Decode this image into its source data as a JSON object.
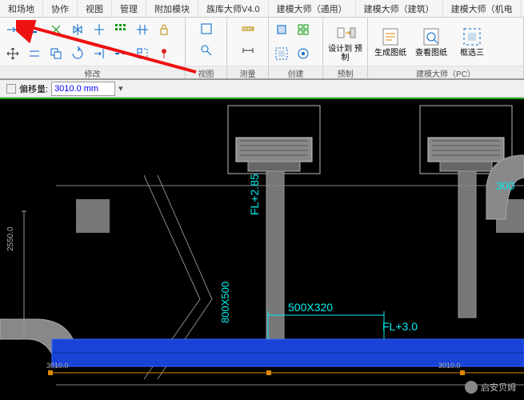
{
  "tabs": [
    "和场地",
    "协作",
    "视图",
    "管理",
    "附加模块",
    "族库大师V4.0",
    "建模大师（通用）",
    "建模大师（建筑）",
    "建模大师（机电"
  ],
  "panels": {
    "modify": "修改",
    "view": "视图",
    "measure": "测量",
    "create": "创建",
    "precast": "预制",
    "pc": "建模大师（PC）"
  },
  "bigButtons": {
    "designTo": "设计到\n预制",
    "genDrawing": "生成图纸",
    "viewDrawing": "查看图纸",
    "boxSelect": "框选三"
  },
  "offset": {
    "label": "偏移量:",
    "value": "3010.0 mm"
  },
  "annotations": {
    "fl285": "FL+2.85",
    "fl30": "FL+3.0",
    "dim500x320": "500X320",
    "dim300": "300",
    "dim2550": "2550.0",
    "dim3010L": "3010.0",
    "dim3010R": "3010.0",
    "dim800x500": "800X500"
  },
  "watermark": "启安贝姆"
}
